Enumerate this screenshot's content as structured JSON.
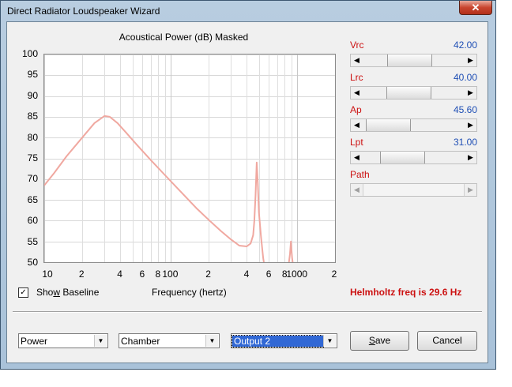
{
  "window": {
    "title": "Direct Radiator Loudspeaker Wizard",
    "close_glyph": "✕"
  },
  "chart_data": {
    "type": "line",
    "title": "Acoustical Power (dB)   Masked",
    "xlabel": "Frequency (hertz)",
    "ylabel": "",
    "x_scale": "log",
    "xlim": [
      10,
      2000
    ],
    "ylim": [
      50,
      100
    ],
    "y_ticks": [
      "100",
      "95",
      "90",
      "85",
      "80",
      "75",
      "70",
      "65",
      "60",
      "55",
      "50"
    ],
    "x_ticks": [
      {
        "value": 10,
        "label": "10"
      },
      {
        "value": 20,
        "label": "2"
      },
      {
        "value": 40,
        "label": "4"
      },
      {
        "value": 60,
        "label": "6"
      },
      {
        "value": 80,
        "label": "8"
      },
      {
        "value": 100,
        "label": "100"
      },
      {
        "value": 200,
        "label": "2"
      },
      {
        "value": 400,
        "label": "4"
      },
      {
        "value": 600,
        "label": "6"
      },
      {
        "value": 800,
        "label": "8"
      },
      {
        "value": 1000,
        "label": "1000"
      },
      {
        "value": 2000,
        "label": "2"
      }
    ],
    "series": [
      {
        "color": "#f0a8a0",
        "segments": [
          {
            "x": [
              10,
              12,
              15,
              20,
              25,
              30,
              33,
              38,
              45,
              55,
              70,
              90,
              120,
              160,
              200,
              250,
              300,
              350,
              400,
              430,
              450,
              460,
              470,
              480,
              490,
              500,
              520,
              540,
              550
            ],
            "y": [
              68.5,
              71.5,
              75.5,
              80,
              83.5,
              85.2,
              85,
              83.5,
              81,
              78,
              74.5,
              71,
              67,
              63,
              60.2,
              57.5,
              55.5,
              54,
              53.8,
              54.5,
              56.5,
              60,
              66,
              74,
              69,
              62,
              56,
              51,
              49.5
            ]
          },
          {
            "x": [
              860,
              880,
              895,
              905,
              915,
              930
            ],
            "y": [
              49.5,
              52,
              55,
              53,
              51,
              49.5
            ]
          }
        ]
      }
    ],
    "grid": true
  },
  "sliders": [
    {
      "label": "Vrc",
      "value": "42.00",
      "fraction": 0.43,
      "enabled": true
    },
    {
      "label": "Lrc",
      "value": "40.00",
      "fraction": 0.41,
      "enabled": true
    },
    {
      "label": "Ap",
      "value": "45.60",
      "fraction": 0.06,
      "enabled": true
    },
    {
      "label": "Lpt",
      "value": "31.00",
      "fraction": 0.31,
      "enabled": true
    },
    {
      "label": "Path",
      "value": "",
      "fraction": null,
      "enabled": false
    }
  ],
  "show_baseline": {
    "label": "Show Baseline",
    "checked": true,
    "mark": "✓"
  },
  "helmholtz_text": "Helmholtz freq is 29.6 Hz",
  "combos": [
    {
      "value": "Power",
      "arrow": "▼"
    },
    {
      "value": "Chamber",
      "arrow": "▼"
    },
    {
      "value": "Output 2",
      "arrow": "▼"
    }
  ],
  "buttons": {
    "save": "Save",
    "cancel": "Cancel"
  },
  "colors": {
    "accent_red": "#cc1111",
    "value_blue": "#1f4fb5",
    "curve": "#f0a8a0",
    "selection": "#3168d5"
  }
}
